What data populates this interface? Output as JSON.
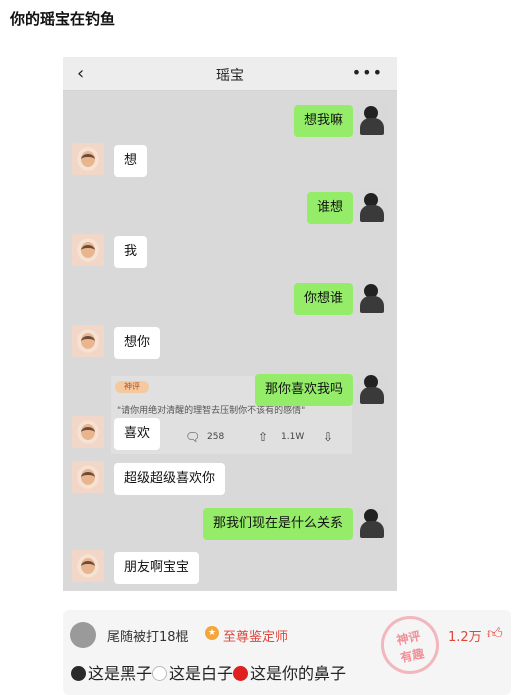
{
  "post": {
    "title": "你的瑶宝在钓鱼"
  },
  "chat": {
    "title": "瑶宝",
    "back_icon": "back-arrow-icon",
    "more_icon": "more-dots-icon",
    "messages": [
      {
        "from": "me",
        "text": "想我嘛"
      },
      {
        "from": "her",
        "text": "想"
      },
      {
        "from": "me",
        "text": "谁想"
      },
      {
        "from": "her",
        "text": "我"
      },
      {
        "from": "me",
        "text": "你想谁"
      },
      {
        "from": "her",
        "text": "想你"
      },
      {
        "from": "me",
        "text": "那你喜欢我吗"
      },
      {
        "from": "her",
        "text": "喜欢"
      },
      {
        "from": "her",
        "text": "超级超级喜欢你"
      },
      {
        "from": "me",
        "text": "那我们现在是什么关系"
      },
      {
        "from": "her",
        "text": "朋友啊宝宝"
      }
    ],
    "overlay": {
      "badge": "神评",
      "quote": "\"请你用绝对清醒的理智去压制你不该有的感情\"",
      "comments": "258",
      "likes": "1.1W"
    }
  },
  "comment": {
    "user": "尾随被打18棍",
    "badge": "至尊鉴定师",
    "likes": "1.2万",
    "text_parts": [
      "这是黑子",
      "这是白子",
      "这是你的鼻子"
    ],
    "stamp_line1": "神评",
    "stamp_line2": "有趣",
    "colors": {
      "accent": "#e0463a",
      "me_bubble": "#95ec69",
      "her_bubble": "#ffffff"
    }
  }
}
